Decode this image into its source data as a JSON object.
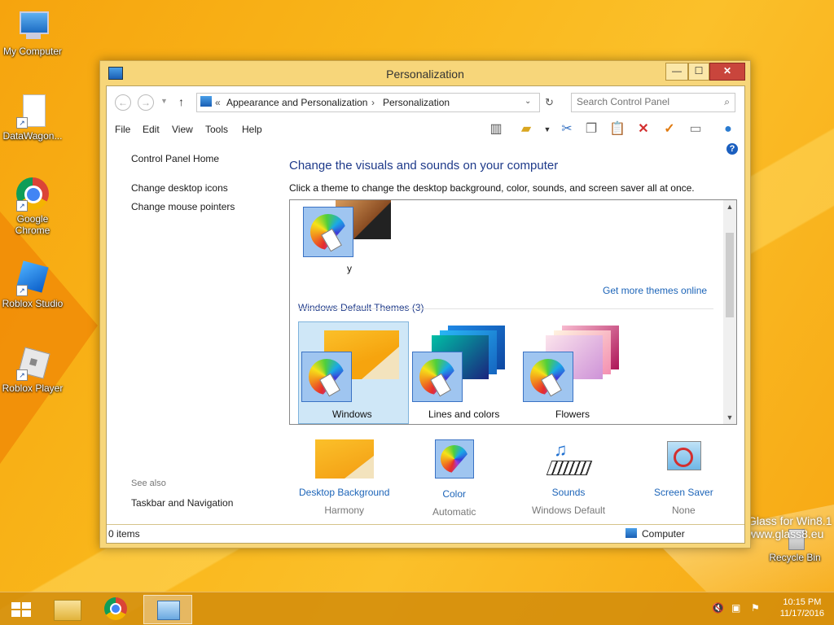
{
  "desktop": {
    "icons": [
      {
        "label": "My Computer"
      },
      {
        "label": "DataWagon..."
      },
      {
        "label": "Google Chrome"
      },
      {
        "label": "Roblox Studio"
      },
      {
        "label": "Roblox Player"
      },
      {
        "label": "Recycle Bin"
      }
    ],
    "watermark": {
      "line1": "Glass for Win8.1",
      "line2": "www.glass8.eu"
    }
  },
  "window": {
    "title": "Personalization",
    "controls": {
      "minimize": "—",
      "maximize": "☐",
      "close": "✕"
    },
    "address": {
      "overflow": "«",
      "crumbs": [
        "Appearance and Personalization",
        "Personalization"
      ],
      "search_placeholder": "Search Control Panel"
    },
    "menu": [
      "File",
      "Edit",
      "View",
      "Tools",
      "Help"
    ],
    "toolbar_icons": [
      "layout-icon",
      "folder-properties-icon",
      "cut-icon",
      "copy-icon",
      "paste-icon",
      "delete-icon",
      "check-icon",
      "rename-icon",
      "globe-icon"
    ],
    "leftnav": {
      "home": "Control Panel Home",
      "links": [
        "Change desktop icons",
        "Change mouse pointers"
      ],
      "see_also": "See also",
      "see_also_links": [
        "Taskbar and Navigation"
      ]
    },
    "main": {
      "heading": "Change the visuals and sounds on your computer",
      "subheading": "Click a theme to change the desktop background, color, sounds, and screen saver all at once.",
      "my_themes": [
        {
          "name": "y"
        }
      ],
      "get_more": "Get more themes online",
      "default_group": "Windows Default Themes (3)",
      "default_themes": [
        {
          "name": "Windows",
          "selected": true
        },
        {
          "name": "Lines and colors",
          "selected": false
        },
        {
          "name": "Flowers",
          "selected": false
        }
      ]
    },
    "bottom": [
      {
        "link": "Desktop Background",
        "value": "Harmony"
      },
      {
        "link": "Color",
        "value": "Automatic"
      },
      {
        "link": "Sounds",
        "value": "Windows Default"
      },
      {
        "link": "Screen Saver",
        "value": "None"
      }
    ],
    "status": {
      "items": "0 items",
      "location": "Computer"
    }
  },
  "taskbar": {
    "time": "10:15 PM",
    "date": "11/17/2016"
  }
}
